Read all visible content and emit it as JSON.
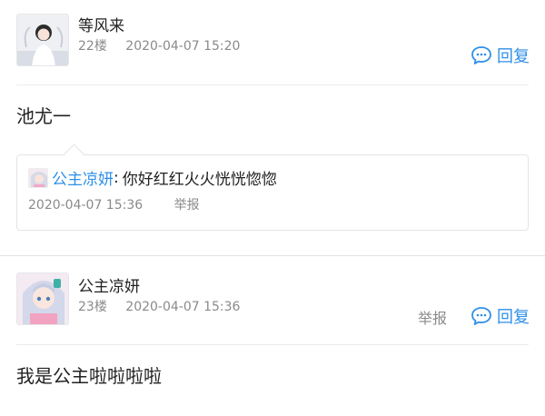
{
  "posts": [
    {
      "username": "等风来",
      "floor": "22楼",
      "timestamp": "2020-04-07 15:20",
      "reply_label": "回复",
      "content": "池尤一",
      "quote": {
        "username": "公主凉妍",
        "colon": ":",
        "text": "你好红红火火恍恍惚惚",
        "timestamp": "2020-04-07 15:36",
        "report_label": "举报"
      }
    },
    {
      "username": "公主凉妍",
      "floor": "23楼",
      "timestamp": "2020-04-07 15:36",
      "report_label": "举报",
      "reply_label": "回复",
      "content": "我是公主啦啦啦啦"
    }
  ],
  "icons": {
    "reply_icon": "chat-bubble-icon"
  },
  "colors": {
    "accent": "#2f8fe8",
    "meta_text": "#8a8a8a",
    "divider": "#ececec"
  }
}
